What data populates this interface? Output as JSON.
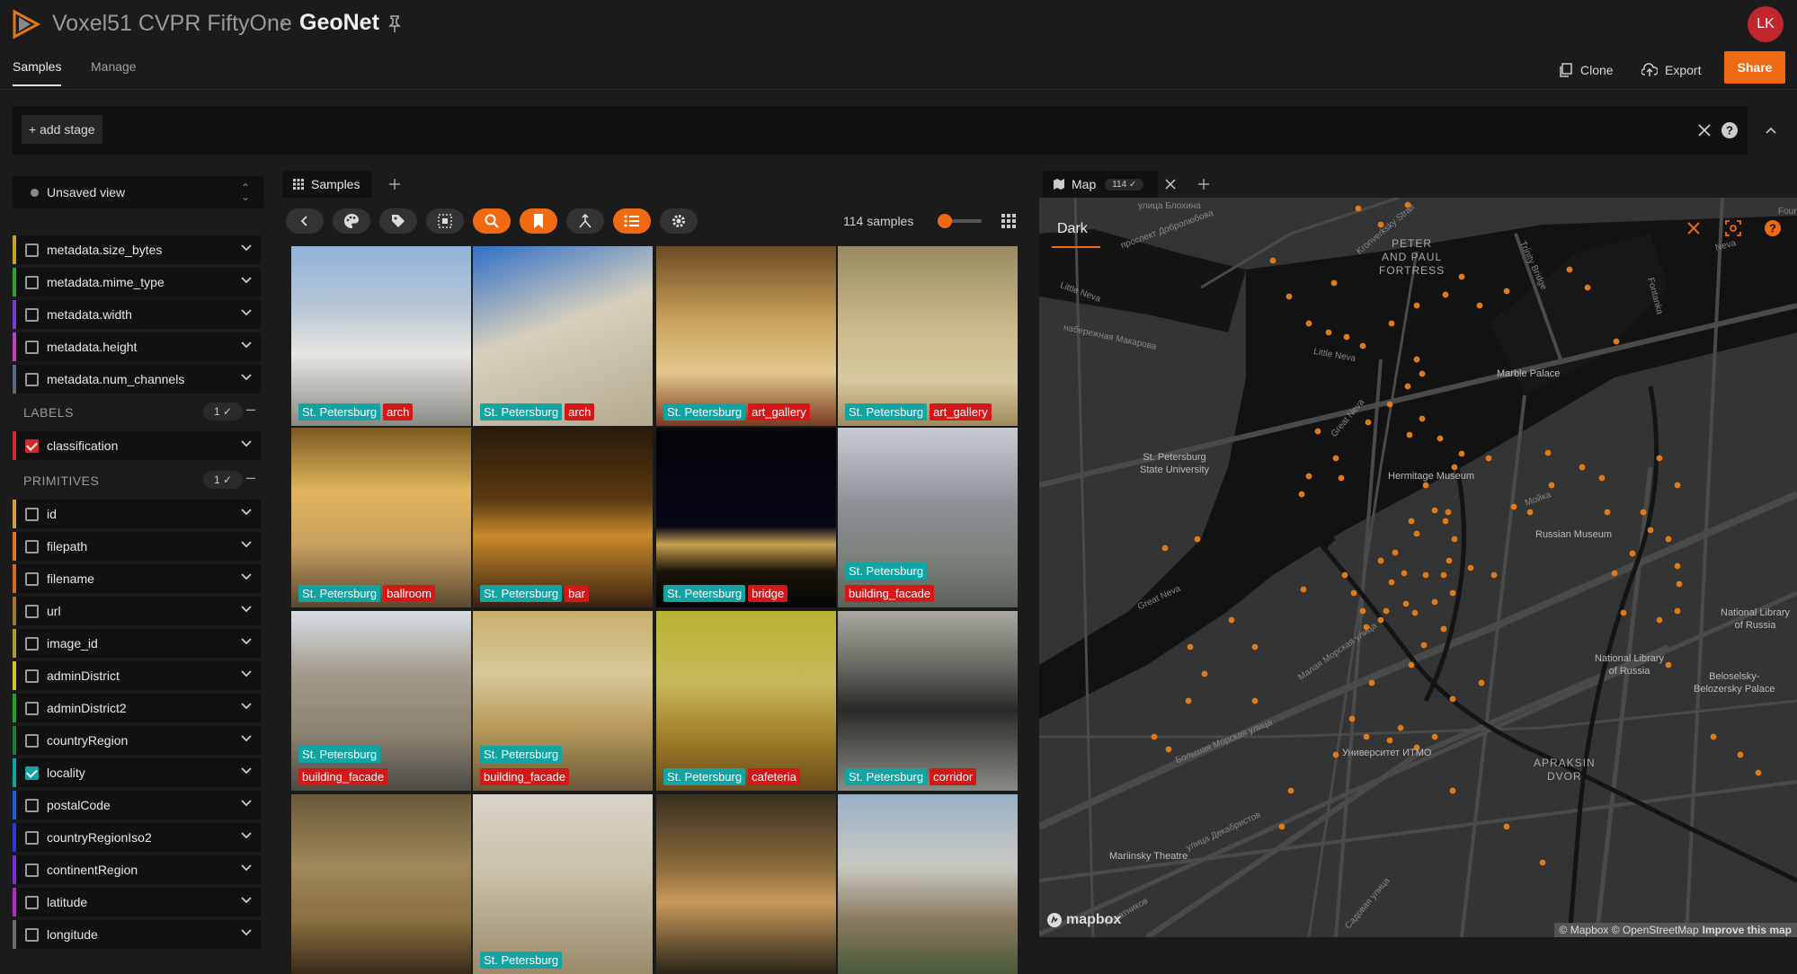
{
  "header": {
    "dataset_group": "Voxel51 CVPR FiftyOne",
    "separator": "›",
    "dataset_name": "GeoNet",
    "avatar_initials": "LK",
    "tabs": [
      {
        "label": "Samples"
      },
      {
        "label": "Manage"
      }
    ],
    "clone_label": "Clone",
    "export_label": "Export",
    "share_label": "Share"
  },
  "view_bar": {
    "add_stage_label": "+ add stage"
  },
  "sidebar": {
    "view_selector": "Unsaved view",
    "metadata_fields": [
      {
        "name": "metadata.size_bytes",
        "color": "#c6a21d",
        "checked": false
      },
      {
        "name": "metadata.mime_type",
        "color": "#29a329",
        "checked": false
      },
      {
        "name": "metadata.width",
        "color": "#7a3ad8",
        "checked": false
      },
      {
        "name": "metadata.height",
        "color": "#c03ccb",
        "checked": false
      },
      {
        "name": "metadata.num_channels",
        "color": "#5a6a7a",
        "checked": false
      }
    ],
    "labels_group": {
      "title": "LABELS",
      "count": "1 ✓"
    },
    "label_fields": [
      {
        "name": "classification",
        "color": "#d12a2a",
        "checked": true
      }
    ],
    "primitives_group": {
      "title": "PRIMITIVES",
      "count": "1 ✓"
    },
    "primitive_fields": [
      {
        "name": "id",
        "color": "#d2a030",
        "checked": false
      },
      {
        "name": "filepath",
        "color": "#e07818",
        "checked": false
      },
      {
        "name": "filename",
        "color": "#d96a1a",
        "checked": false
      },
      {
        "name": "url",
        "color": "#a5772a",
        "checked": false
      },
      {
        "name": "image_id",
        "color": "#b09a22",
        "checked": false
      },
      {
        "name": "adminDistrict",
        "color": "#d4c22a",
        "checked": false
      },
      {
        "name": "adminDistrict2",
        "color": "#23a323",
        "checked": false
      },
      {
        "name": "countryRegion",
        "color": "#1f7a3a",
        "checked": false
      },
      {
        "name": "locality",
        "color": "#12a3a3",
        "checked": true
      },
      {
        "name": "postalCode",
        "color": "#1a5fd4",
        "checked": false
      },
      {
        "name": "countryRegionIso2",
        "color": "#2a3ad8",
        "checked": false
      },
      {
        "name": "continentRegion",
        "color": "#7a2ad8",
        "checked": false
      },
      {
        "name": "latitude",
        "color": "#b32ac8",
        "checked": false
      },
      {
        "name": "longitude",
        "color": "#6a6a6a",
        "checked": false
      }
    ]
  },
  "samples_panel": {
    "tab_label": "Samples",
    "sample_count": "114 samples",
    "grid_zoom_fraction": 0.15,
    "tiles": [
      {
        "locality": "St. Petersburg",
        "label": "arch"
      },
      {
        "locality": "St. Petersburg",
        "label": "arch"
      },
      {
        "locality": "St. Petersburg",
        "label": "art_gallery"
      },
      {
        "locality": "St. Petersburg",
        "label": "art_gallery"
      },
      {
        "locality": "St. Petersburg",
        "label": "ballroom"
      },
      {
        "locality": "St. Petersburg",
        "label": "bar"
      },
      {
        "locality": "St. Petersburg",
        "label": "bridge"
      },
      {
        "locality": "St. Petersburg",
        "label": "building_facade"
      },
      {
        "locality": "St. Petersburg",
        "label": "building_facade"
      },
      {
        "locality": "St. Petersburg",
        "label": "building_facade"
      },
      {
        "locality": "St. Petersburg",
        "label": "cafeteria"
      },
      {
        "locality": "St. Petersburg",
        "label": "corridor"
      },
      {
        "locality": "",
        "label": ""
      },
      {
        "locality": "St. Petersburg",
        "label": ""
      },
      {
        "locality": "",
        "label": ""
      },
      {
        "locality": "",
        "label": ""
      }
    ],
    "colors": {
      "locality": "#12a3a3",
      "label": "#d41818"
    }
  },
  "map_panel": {
    "tab_label": "Map",
    "tab_count": "114 ✓",
    "style_label": "Dark",
    "attribution": "© Mapbox © OpenStreetMap",
    "improve_label": "Improve this map",
    "logo_text": "mapbox",
    "places": [
      "PETER AND PAUL FORTRESS",
      "Marble Palace",
      "St. Petersburg State University",
      "Hermitage Museum",
      "Russian Museum",
      "National Library of Russia",
      "Beloselsky-Belozersky Palace",
      "APRAKSIN DVOR",
      "Mariinsky Theatre",
      "Университет ИТМО",
      "National Library of Russia"
    ],
    "streets": [
      "улица Блохина",
      "проспект Добролюбова",
      "Kronverksky Strait",
      "Trinity Bridge",
      "Little Neva",
      "набережная Макарова",
      "Fontanka",
      "Neva",
      "Great Neva",
      "Малая Морская улица",
      "Большая Морская улица",
      "улица Декабристов",
      "Садовая улица",
      "Мойка",
      "Four",
      "Little Neva",
      "Great Neva",
      "Печатников"
    ]
  }
}
